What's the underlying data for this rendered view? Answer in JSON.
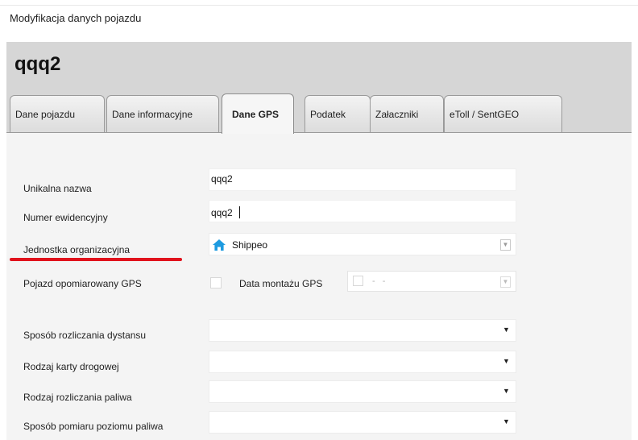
{
  "window": {
    "title": "Modyfikacja danych pojazdu"
  },
  "record": {
    "title": "qqq2"
  },
  "tabs": [
    {
      "label": "Dane pojazdu"
    },
    {
      "label": "Dane informacyjne"
    },
    {
      "label": "Dane GPS"
    },
    {
      "label": "Podatek"
    },
    {
      "label": "Załaczniki"
    },
    {
      "label": "eToll / SentGEO"
    }
  ],
  "form": {
    "unique_name": {
      "label": "Unikalna nazwa",
      "value": "qqq2"
    },
    "registration_number": {
      "label": "Numer ewidencyjny",
      "value": "qqq2"
    },
    "org_unit": {
      "label": "Jednostka organizacyjna",
      "value": "Shippeo",
      "icon": "home-icon"
    },
    "gps_measured": {
      "label": "Pojazd opomiarowany GPS",
      "checked": false
    },
    "gps_install_date": {
      "label": "Data montażu GPS",
      "checked": false,
      "placeholder": "- -"
    },
    "distance_method": {
      "label": "Sposób rozliczania dystansu",
      "value": ""
    },
    "road_card_type": {
      "label": "Rodzaj karty drogowej",
      "value": ""
    },
    "fuel_settlement": {
      "label": "Rodzaj rozliczania paliwa",
      "value": ""
    },
    "fuel_level_method": {
      "label": "Sposób pomiaru poziomu paliwa",
      "value": ""
    }
  },
  "colors": {
    "header_bg": "#d6d6d6",
    "panel_bg": "#f4f4f4",
    "highlight_underline": "#e0121c",
    "home_icon": "#1e9be0"
  }
}
